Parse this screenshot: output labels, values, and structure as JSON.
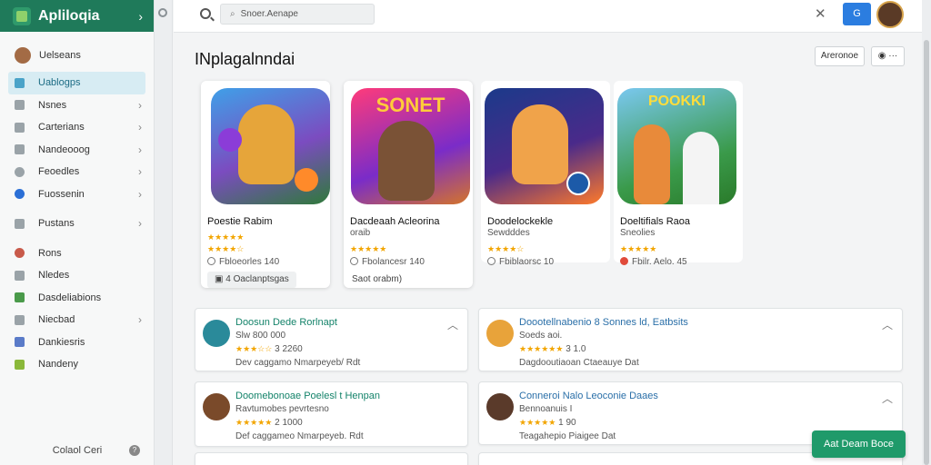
{
  "app": {
    "title": "Apliloqia"
  },
  "sidebar": {
    "user_label": "Uelseans",
    "items": [
      {
        "label": "Uablogps",
        "active": true,
        "chevron": false
      },
      {
        "label": "Nsnes",
        "chevron": true
      },
      {
        "label": "Carterians",
        "chevron": true
      },
      {
        "label": "Nandeooog",
        "chevron": true
      },
      {
        "label": "Feoedles",
        "chevron": true
      },
      {
        "label": "Fuossenin",
        "chevron": true
      },
      {
        "label": "Pustans",
        "chevron": true
      },
      {
        "label": "Rons",
        "chevron": false
      },
      {
        "label": "Nledes",
        "chevron": false
      },
      {
        "label": "Dasdeliabions",
        "chevron": false
      },
      {
        "label": "Niecbad",
        "chevron": true
      },
      {
        "label": "Dankiesris",
        "chevron": false
      },
      {
        "label": "Nandeny",
        "chevron": false
      }
    ],
    "footer": "Colaol Ceri",
    "help_glyph": "?"
  },
  "topbar": {
    "search_placeholder": "Snoer.Aenape",
    "close_glyph": "✕",
    "action_glyph": "G"
  },
  "main": {
    "title": "INplagalnndai",
    "header_button": "Areronoe",
    "more_button": "◉ ···",
    "cards": [
      {
        "name": "Poestie Rabim",
        "sub": "",
        "stars": "★★★★★",
        "stars2": "★★★★☆",
        "meta": "Fbloeorles 140",
        "pill": "▣ 4 Oaclanptsgas"
      },
      {
        "name": "Dacdeaah Acleorina",
        "sub": "oraib",
        "stars": "★★★★★",
        "stars2": "",
        "meta": "Fbolancesr 140",
        "pill": "Saot orabm)"
      },
      {
        "name": "Doodelockekle",
        "sub": "Sewdddes",
        "stars": "★★★★☆",
        "stars2": "",
        "meta": "Fbiblaorsc 10",
        "pill": ""
      },
      {
        "name": "Doeltifials Raoa",
        "sub": "Sneolies",
        "stars": "★★★★★",
        "stars2": "",
        "meta": "Fbilr. Aelo. 45",
        "pill": ""
      }
    ],
    "list": [
      {
        "title": "Doosun Dede Rorlnapt",
        "sub": "Slw 800 000",
        "stars": "★★★☆☆",
        "rating": "3 2260",
        "meta": "Dev caggamo Nmarpeyeb/ Rdt"
      },
      {
        "title": "Doootellnabenio 8 Sonnes ld, Eatbsits",
        "sub": "Soeds aoi.",
        "stars": "★★★★★★",
        "rating": "3 1.0",
        "meta": "Dagdooutiaoan Ctaeauye Dat"
      },
      {
        "title": "Doomebonoae Poelesl t Henpan",
        "sub": "Ravtumobes pevrtesno",
        "stars": "★★★★★",
        "rating": "2 1000",
        "meta": "Def caggameo Nmarpeyeb. Rdt"
      },
      {
        "title": "Conneroi Nalo Leoconie Daaes",
        "sub": "Bennoanuis I",
        "stars": "★★★★★",
        "rating": "1 90",
        "meta": "Teagahepio Piaigee Dat"
      }
    ],
    "fab_label": "Aat Deam Boce"
  }
}
